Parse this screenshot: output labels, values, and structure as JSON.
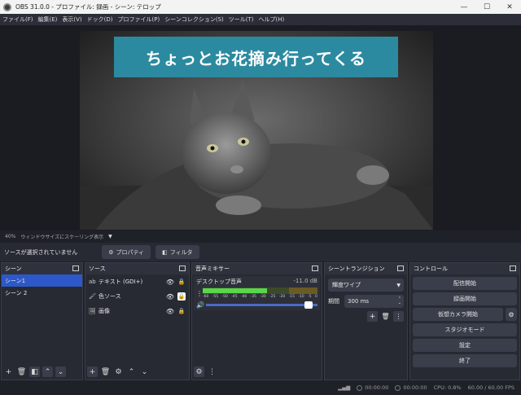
{
  "window": {
    "title": "OBS 31.0.0 - プロファイル: 録画 - シーン: テロップ",
    "minimize": "—",
    "maximize": "☐",
    "close": "✕"
  },
  "menu": [
    "ファイル(F)",
    "編集(E)",
    "表示(V)",
    "ドック(D)",
    "プロファイル(P)",
    "シーンコレクション(S)",
    "ツール(T)",
    "ヘルプ(H)"
  ],
  "preview": {
    "caption": "ちょっとお花摘み行ってくる"
  },
  "scalebar": {
    "zoom": "40%",
    "mode": "ウィンドウサイズにスケーリング表示",
    "dropdown": "▼"
  },
  "sourcebar": {
    "status": "ソースが選択されていません",
    "properties": "プロパティ",
    "filters": "フィルタ"
  },
  "scenes": {
    "title": "シーン",
    "items": [
      "シーン1",
      "シーン 2"
    ]
  },
  "sources": {
    "title": "ソース",
    "items": [
      {
        "label": "テキスト (GDI+)",
        "icon": "ab"
      },
      {
        "label": "色ソース",
        "icon": "🖌"
      },
      {
        "label": "画像",
        "icon": "🖼"
      }
    ]
  },
  "mixer": {
    "title": "音声ミキサー",
    "channel": "デスクトップ音声",
    "level": "-11.0 dB",
    "scale": [
      "-60",
      "-55",
      "-50",
      "-45",
      "-40",
      "-35",
      "-30",
      "-25",
      "-20",
      "-15",
      "-10",
      "-5",
      "0"
    ],
    "meter_fraction": 0.56,
    "volume_fraction": 0.92
  },
  "transitions": {
    "title": "シーントランジション",
    "type": "輝度ワイプ",
    "duration_label": "期間",
    "duration": "300 ms"
  },
  "controls": {
    "title": "コントロール",
    "stream": "配信開始",
    "record": "録画開始",
    "virtualcam": "仮想カメラ開始",
    "studio": "スタジオモード",
    "settings": "設定",
    "exit": "終了"
  },
  "status": {
    "stream_time": "00:00:00",
    "rec_time": "00:00:00",
    "cpu": "CPU: 0.8%",
    "fps": "60.00 / 60.00 FPS"
  }
}
